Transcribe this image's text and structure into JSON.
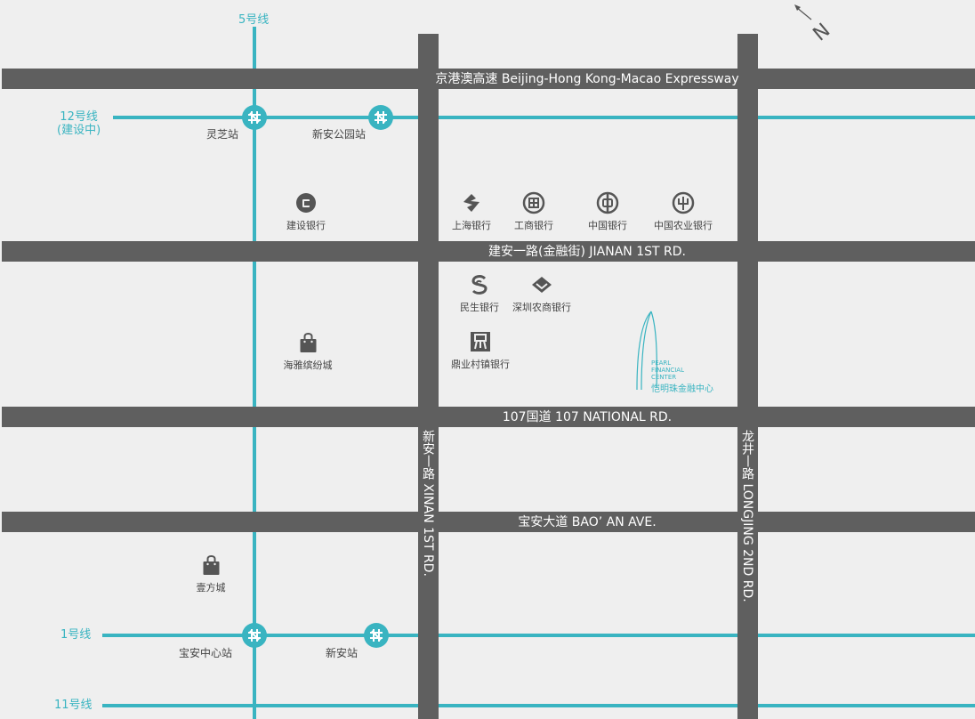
{
  "roads": {
    "expressway": "京港澳高速 Beijing-Hong Kong-Macao Expressway",
    "jianan": "建安一路(金融街) JIANAN 1ST RD.",
    "national107": "107国道 107 NATIONAL RD.",
    "baoan": "宝安大道 BAO’ AN AVE.",
    "xinan": "新安丨路 XINAN 1ST RD.",
    "longjing": "龙井丨路 LONGJING 2ND RD."
  },
  "metro": {
    "line5": "5号线",
    "line12": "12号线\n(建设中)",
    "line1": "1号线",
    "line11": "11号线"
  },
  "stations": {
    "lingzhi": "灵芝站",
    "xinangongyuan": "新安公园站",
    "baoanzhongxin": "宝安中心站",
    "xinan": "新安站"
  },
  "pois": {
    "ccb": "建设银行",
    "shanghai_bank": "上海银行",
    "icbc": "工商银行",
    "boc": "中国银行",
    "abc": "中国农业银行",
    "minsheng": "民生银行",
    "szrcb": "深圳农商银行",
    "dingyecun": "鼎业村镇银行",
    "haiya": "海雅缤纷城",
    "yifang": "壹方城"
  },
  "landmark": {
    "en_line1": "PEARL",
    "en_line2": "FINANCIAL",
    "en_line3": "CENTER",
    "cn": "恺明珠金融中心"
  },
  "compass": {
    "label": "N"
  },
  "colors": {
    "road": "#5f5f5f",
    "metro": "#39b4c1",
    "background": "#efefef"
  }
}
